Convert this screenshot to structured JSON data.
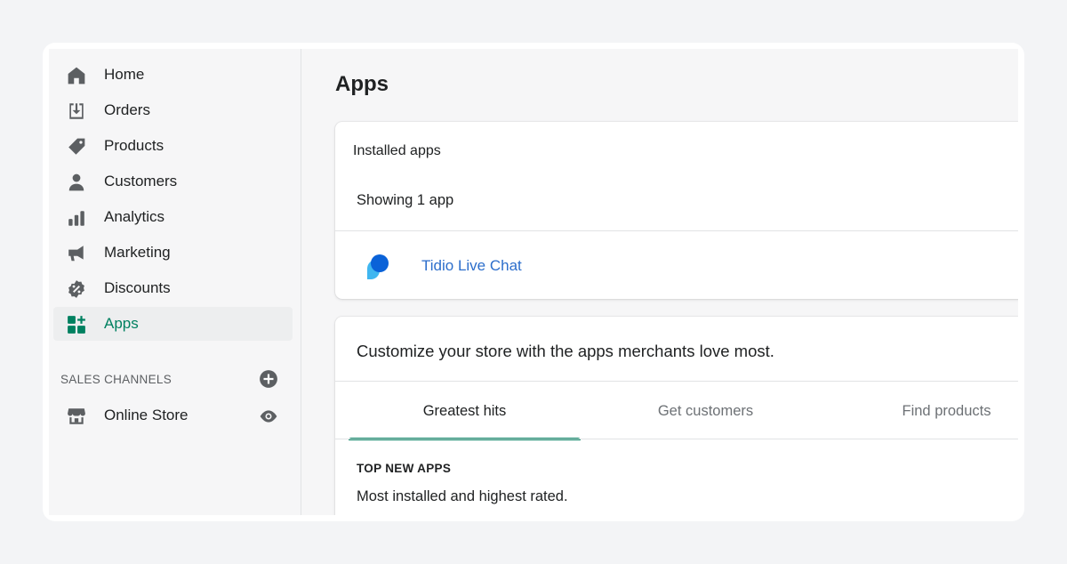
{
  "sidebar": {
    "items": [
      {
        "label": "Home",
        "icon": "home-icon"
      },
      {
        "label": "Orders",
        "icon": "orders-icon"
      },
      {
        "label": "Products",
        "icon": "tag-icon"
      },
      {
        "label": "Customers",
        "icon": "person-icon"
      },
      {
        "label": "Analytics",
        "icon": "bar-chart-icon"
      },
      {
        "label": "Marketing",
        "icon": "megaphone-icon"
      },
      {
        "label": "Discounts",
        "icon": "discount-icon"
      },
      {
        "label": "Apps",
        "icon": "apps-icon",
        "active": true
      }
    ],
    "sales_channels_title": "SALES CHANNELS",
    "channels": [
      {
        "label": "Online Store",
        "icon": "store-icon"
      }
    ]
  },
  "main": {
    "title": "Apps",
    "installed": {
      "title": "Installed apps",
      "showing": "Showing 1 app",
      "apps": [
        {
          "name": "Tidio Live Chat",
          "icon": "chat-bubble-icon"
        }
      ]
    },
    "discover": {
      "title": "Customize your store with the apps merchants love most.",
      "tabs": [
        {
          "label": "Greatest hits",
          "active": true
        },
        {
          "label": "Get customers"
        },
        {
          "label": "Find products"
        }
      ],
      "section_heading": "TOP NEW APPS",
      "section_text": "Most installed and highest rated."
    }
  },
  "colors": {
    "accent": "#008060",
    "link": "#2c6ecb",
    "icon": "#5c5f62",
    "app_icon_dark": "#0a62d8",
    "app_icon_light": "#3fb6f0"
  }
}
